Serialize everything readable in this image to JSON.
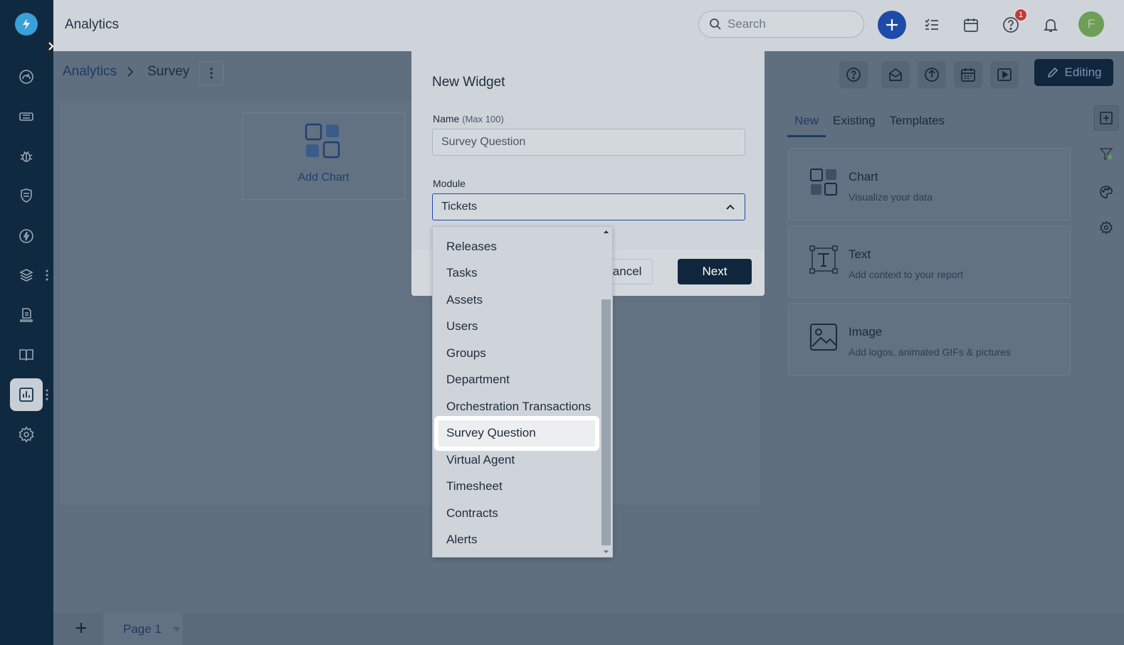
{
  "app": {
    "title": "Analytics"
  },
  "header": {
    "search_placeholder": "Search",
    "help_badge": "1",
    "avatar_initial": "F"
  },
  "breadcrumb": {
    "root": "Analytics",
    "current": "Survey"
  },
  "toolbar": {
    "edit_label": "Editing"
  },
  "canvas": {
    "add_chart_label": "Add Chart"
  },
  "right_panel": {
    "tabs": [
      "New",
      "Existing",
      "Templates"
    ],
    "active_tab": "New",
    "cards": [
      {
        "title": "Chart",
        "subtitle": "Visualize your data",
        "icon": "chart-widget-icon"
      },
      {
        "title": "Text",
        "subtitle": "Add context to your report",
        "icon": "text-widget-icon"
      },
      {
        "title": "Image",
        "subtitle": "Add logos, animated GIFs & pictures",
        "icon": "image-widget-icon"
      }
    ]
  },
  "footer": {
    "page_tab": "Page 1"
  },
  "modal": {
    "title": "New Widget",
    "name_label": "Name",
    "name_hint": "(Max 100)",
    "name_value": "Survey Question",
    "module_label": "Module",
    "module_value": "Tickets",
    "cancel_label": "Cancel",
    "next_label": "Next"
  },
  "dropdown": {
    "options": [
      "Releases",
      "Tasks",
      "Assets",
      "Users",
      "Groups",
      "Department",
      "Orchestration Transactions",
      "Survey Question",
      "Virtual Agent",
      "Timesheet",
      "Contracts",
      "Alerts"
    ],
    "highlighted": "Survey Question"
  },
  "colors": {
    "nav_bg": "#0f2a40",
    "accent_blue": "#1d4ca8",
    "primary_dark": "#10263d",
    "overlay_bg": "#5f6f80"
  }
}
